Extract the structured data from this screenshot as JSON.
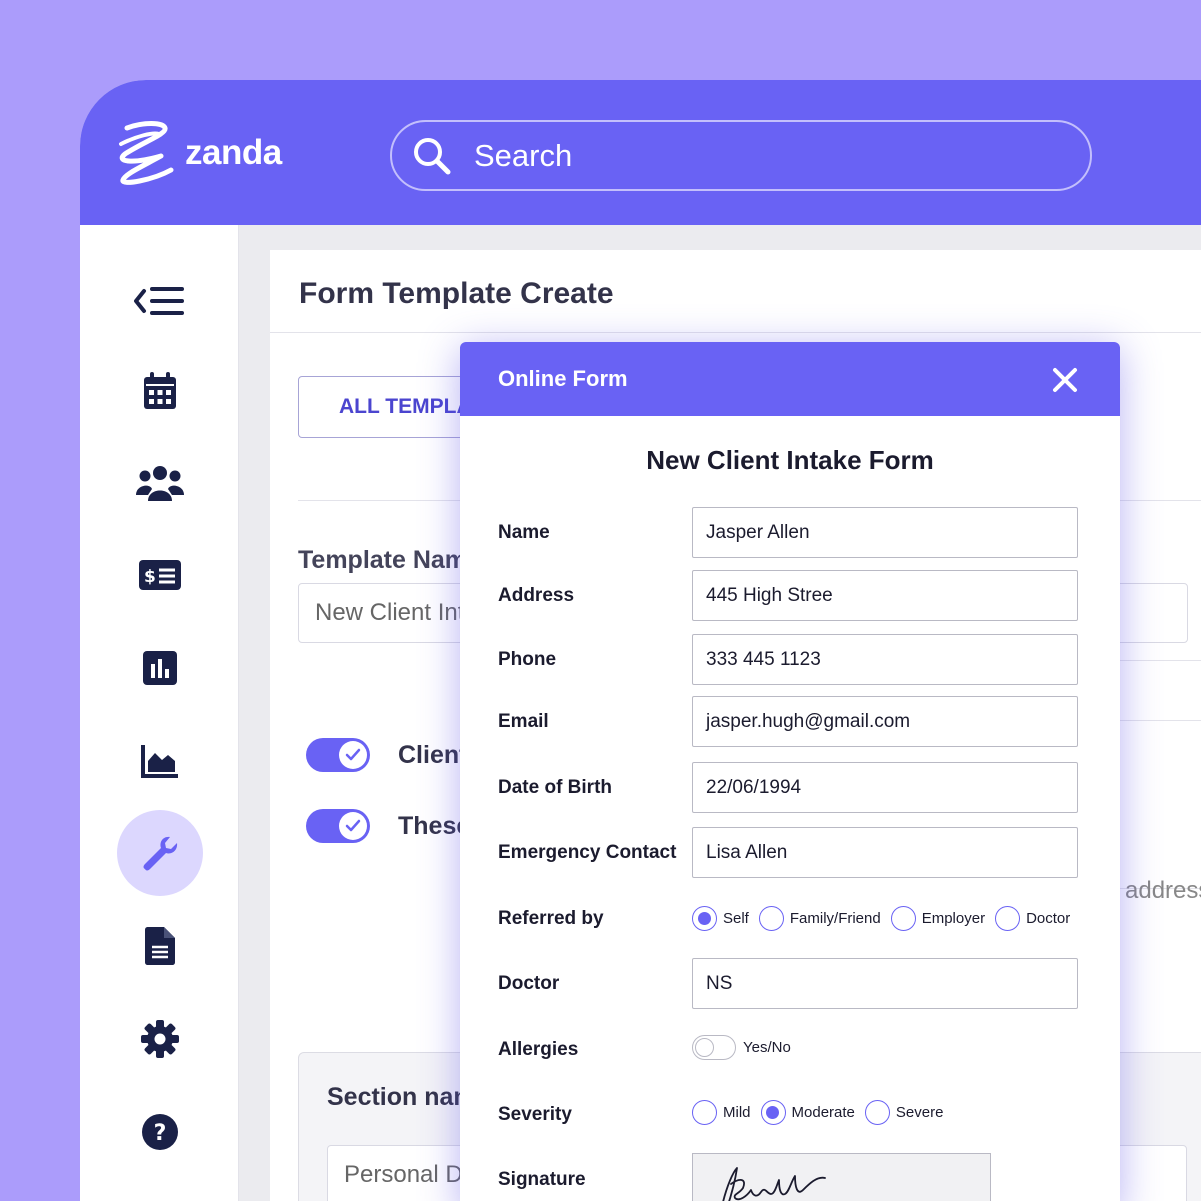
{
  "brand": {
    "name": "zanda"
  },
  "search": {
    "placeholder": "Search"
  },
  "sidebar": {
    "items": [
      {
        "icon": "collapse-menu-icon"
      },
      {
        "icon": "calendar-icon"
      },
      {
        "icon": "clients-icon"
      },
      {
        "icon": "billing-icon"
      },
      {
        "icon": "bar-chart-icon"
      },
      {
        "icon": "area-chart-icon"
      },
      {
        "icon": "wrench-icon",
        "active": true
      },
      {
        "icon": "document-icon"
      },
      {
        "icon": "gear-icon"
      },
      {
        "icon": "help-icon"
      }
    ]
  },
  "page": {
    "title": "Form Template Create",
    "back_label": "ALL TEMPLATES",
    "template_name_label": "Template Name",
    "template_name_value": "New Client Intake Form",
    "toggles": [
      {
        "label": "Client",
        "on": true
      },
      {
        "label": "These",
        "on": true
      }
    ],
    "address_hint": "address",
    "section_label": "Section name",
    "section_value": "Personal Details"
  },
  "modal": {
    "header_title": "Online Form",
    "form_title": "New Client Intake Form",
    "fields": {
      "name": {
        "label": "Name",
        "value": "Jasper Allen"
      },
      "address": {
        "label": "Address",
        "value": "445 High Stree"
      },
      "phone": {
        "label": "Phone",
        "value": "333 445 1123"
      },
      "email": {
        "label": "Email",
        "value": "jasper.hugh@gmail.com"
      },
      "dob": {
        "label": "Date of Birth",
        "value": "22/06/1994"
      },
      "emergency": {
        "label": "Emergency Contact",
        "value": "Lisa Allen"
      },
      "doctor": {
        "label": "Doctor",
        "value": "NS"
      }
    },
    "referred_by": {
      "label": "Referred by",
      "options": [
        "Self",
        "Family/Friend",
        "Employer",
        "Doctor"
      ],
      "selected": "Self"
    },
    "allergies": {
      "label": "Allergies",
      "toggle_label": "Yes/No",
      "on": false
    },
    "severity": {
      "label": "Severity",
      "options": [
        "Mild",
        "Moderate",
        "Severe"
      ],
      "selected": "Moderate"
    },
    "signature": {
      "label": "Signature"
    }
  },
  "colors": {
    "accent": "#6962f4",
    "background": "#ab9cfb",
    "icon": "#1a2147",
    "active_bg": "#dcd7fe"
  }
}
